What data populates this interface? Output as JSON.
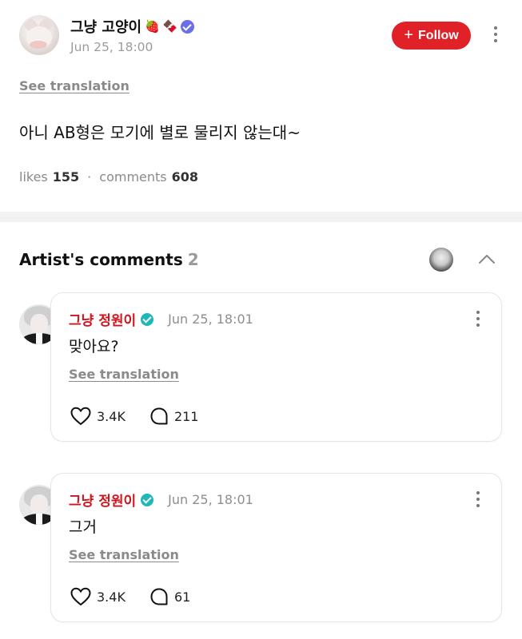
{
  "post": {
    "author": "그냥 고양이",
    "author_emojis": [
      "🍓",
      "🍫"
    ],
    "timestamp": "Jun 25, 18:00",
    "follow_label": "Follow",
    "see_translation": "See translation",
    "text": "아니 AB형은 모기에 별로 물리지 않는대~",
    "likes_label": "likes",
    "likes_count": "155",
    "separator": "·",
    "comments_label": "comments",
    "comments_count": "608"
  },
  "artist_comments": {
    "title": "Artist's comments",
    "count": "2",
    "items": [
      {
        "author": "그냥 정원이",
        "timestamp": "Jun 25, 18:01",
        "text": "맞아요?",
        "see_translation": "See translation",
        "likes": "3.4K",
        "replies": "211"
      },
      {
        "author": "그냥 정원이",
        "timestamp": "Jun 25, 18:01",
        "text": "그거",
        "see_translation": "See translation",
        "likes": "3.4K",
        "replies": "61"
      }
    ]
  },
  "colors": {
    "follow_bg": "#e02128",
    "artist_name": "#d0141c",
    "verified_teal": "#1fb7b7",
    "verified_purple": "#6b6ee6"
  },
  "icons": [
    "more-vertical-icon",
    "plus-icon",
    "verified-badge-icon",
    "chevron-up-icon",
    "heart-icon",
    "comment-bubble-icon"
  ]
}
